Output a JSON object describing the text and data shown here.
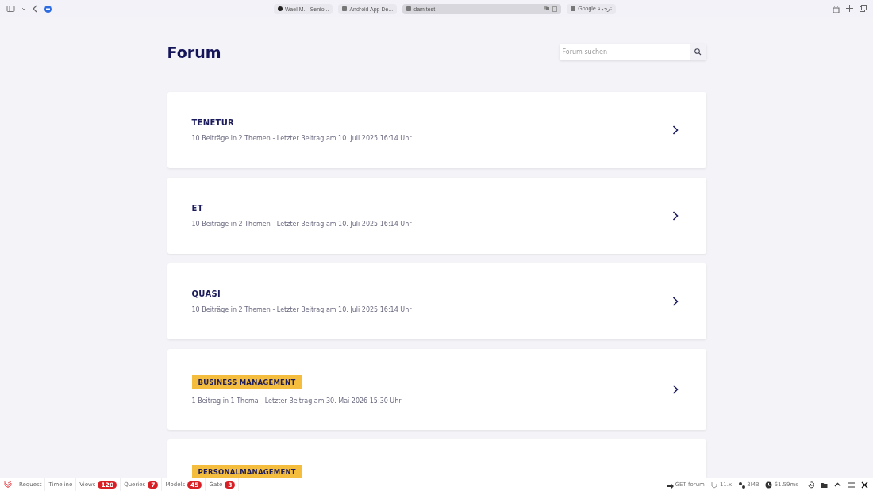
{
  "browser": {
    "tabs": [
      {
        "label": "Wael M. - Senio...",
        "selected": false,
        "kind": "profile"
      },
      {
        "label": "Android App De...",
        "selected": false,
        "kind": "page"
      },
      {
        "label": "dam.test",
        "selected": true,
        "kind": "page"
      },
      {
        "label": "Google ترجمة",
        "selected": false,
        "kind": "page"
      }
    ]
  },
  "page": {
    "title": "Forum",
    "search": {
      "placeholder": "Forum suchen"
    }
  },
  "forums": [
    {
      "kind": "plain",
      "name": "TENETUR",
      "summary": "10 Beiträge in 2 Themen - Letzter Beitrag am 10. Juli 2025 16:14 Uhr"
    },
    {
      "kind": "plain",
      "name": "ET",
      "summary": "10 Beiträge in 2 Themen - Letzter Beitrag am 10. Juli 2025 16:14 Uhr"
    },
    {
      "kind": "plain",
      "name": "QUASI",
      "summary": "10 Beiträge in 2 Themen - Letzter Beitrag am 10. Juli 2025 16:14 Uhr"
    },
    {
      "kind": "tag",
      "name": "BUSINESS MANAGEMENT",
      "summary": "1 Beitrag in 1 Thema - Letzter Beitrag am 30. Mai 2026 15:30 Uhr"
    },
    {
      "kind": "tag",
      "name": "PERSONALMANAGEMENT"
    }
  ],
  "debugbar": {
    "tabs": [
      {
        "label": "Request"
      },
      {
        "label": "Timeline"
      },
      {
        "label": "Views",
        "count": "120"
      },
      {
        "label": "Queries",
        "count": "7"
      },
      {
        "label": "Models",
        "count": "45"
      },
      {
        "label": "Gate",
        "count": "3"
      }
    ],
    "route": "GET forum",
    "version": "11.x",
    "memory": "3MB",
    "duration": "61.59ms"
  }
}
